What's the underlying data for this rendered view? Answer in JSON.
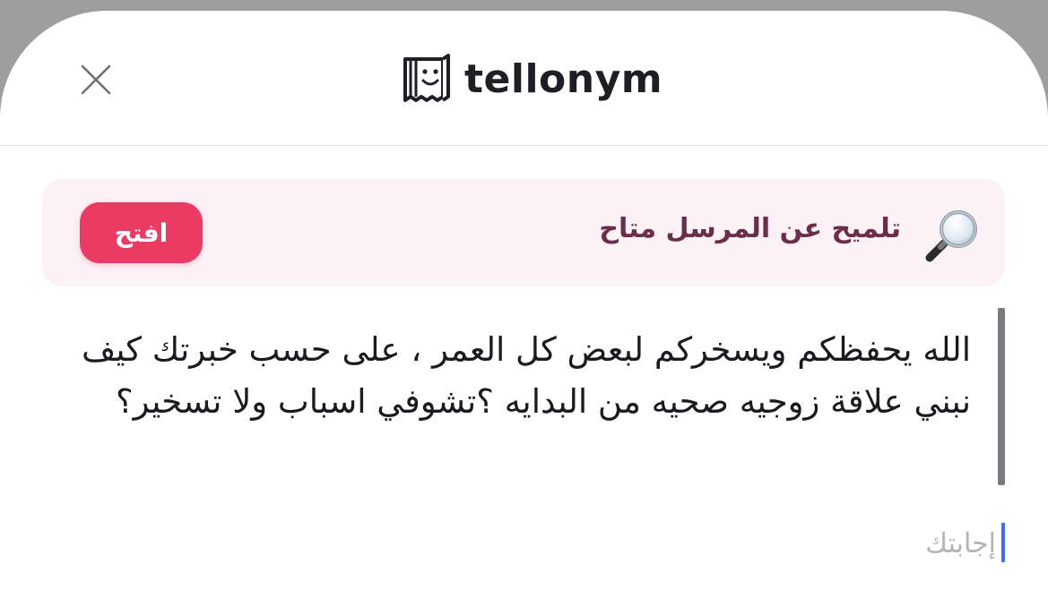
{
  "header": {
    "brand_name": "tellonym",
    "close_icon": "close-icon",
    "logo_icon": "tellonym-logo-icon"
  },
  "hint_banner": {
    "icon": "magnifier-icon",
    "text": "تلميح عن المرسل متاح",
    "button_label": "افتح",
    "colors": {
      "background": "#fcf1f4",
      "text": "#6a2d4b",
      "button": "#ea3b65"
    }
  },
  "question": {
    "text": "الله يحفظكم ويسخركم لبعض كل العمر ، على حسب خبرتك كيف نبني علاقة زوجيه صحيه من البدايه ؟تشوفي اسباب ولا تسخير؟"
  },
  "answer": {
    "value": "",
    "placeholder": "إجابتك",
    "caret_color": "#3b6df5"
  }
}
